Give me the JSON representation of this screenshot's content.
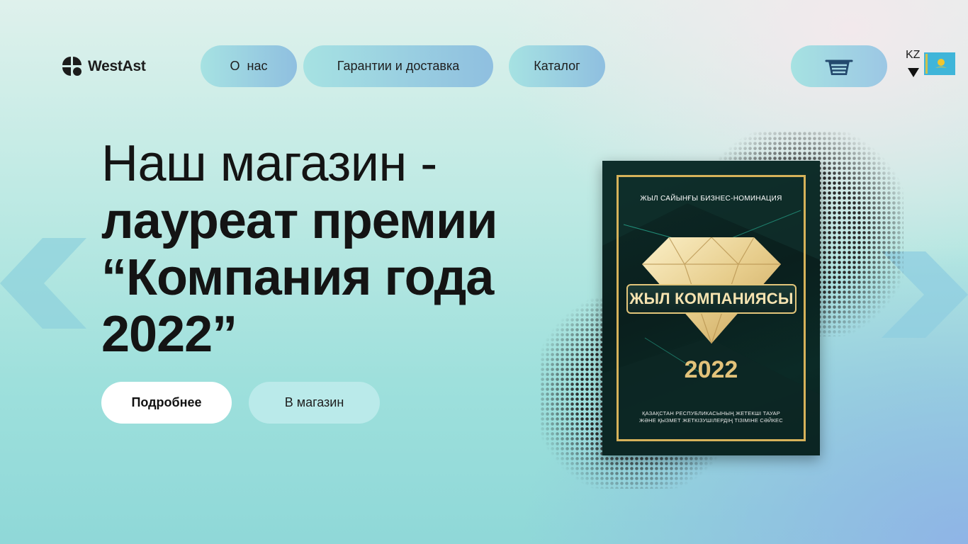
{
  "header": {
    "logo_text": "WestAst",
    "nav": [
      {
        "label": "О  нас"
      },
      {
        "label": "Гарантии и доставка"
      },
      {
        "label": "Каталог"
      }
    ],
    "cart_icon": "basket-icon",
    "language": {
      "code": "KZ",
      "flag": "kazakhstan-flag"
    }
  },
  "hero": {
    "title_line1": "Наш магазин -",
    "title_line2": "лауреат премии",
    "title_line3": "“Компания года",
    "title_line4": "2022”",
    "btn_more": "Подробнее",
    "btn_shop": "В магазин"
  },
  "award": {
    "top_text": "ЖЫЛ САЙЫНҒЫ БИЗНЕС-НОМИНАЦИЯ",
    "banner": "ЖЫЛ КОМПАНИЯСЫ",
    "year": "2022",
    "bottom_line1": "ҚАЗАҚСТАН РЕСПУБЛИКАСЫНЫҢ ЖЕТЕКШІ ТАУАР",
    "bottom_line2": "ЖӘНЕ ҚЫЗМЕТ ЖЕТКІЗУШІЛЕРДІҢ ТІЗІМІНЕ СӘЙКЕС"
  },
  "colors": {
    "award_gold": "#d6b25a",
    "award_dark": "#0a1f1d",
    "nav_pill_start": "#a6e2e2",
    "nav_pill_end": "#8fbfe0"
  }
}
